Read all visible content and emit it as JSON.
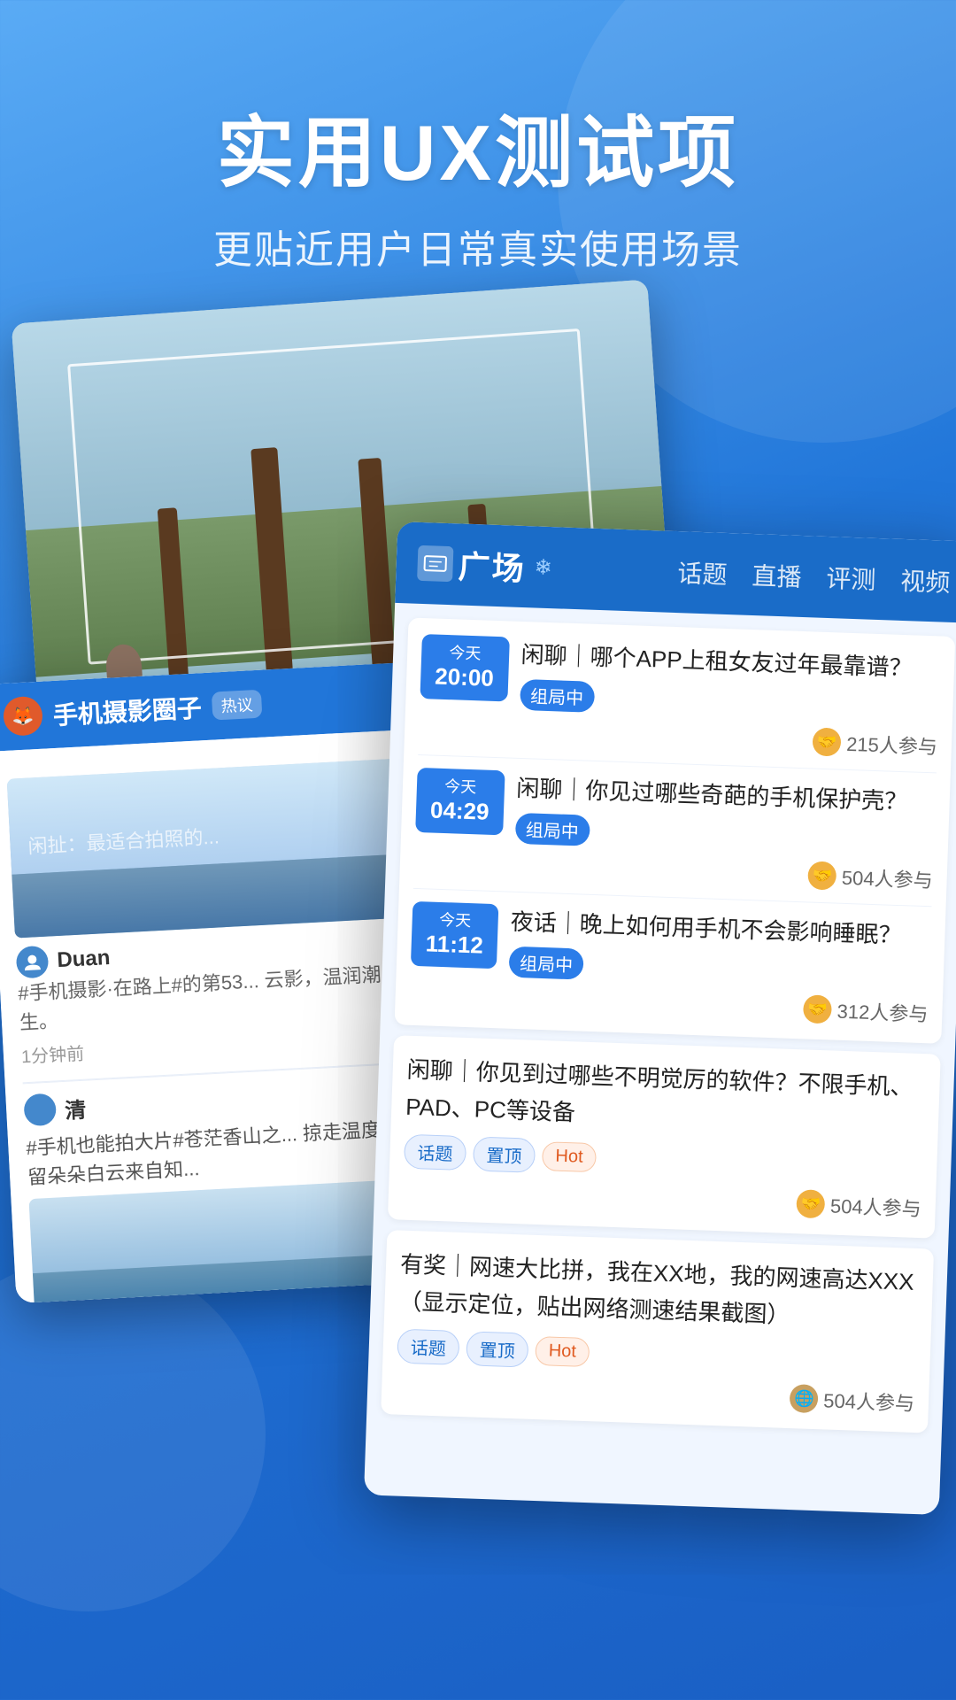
{
  "header": {
    "main_title": "实用UX测试项",
    "sub_title": "更贴近用户日常真实使用场景"
  },
  "photo_card": {
    "alt": "outdoor photo with frame overlay"
  },
  "social_card": {
    "title": "手机摄影圈子",
    "hot_badge": "热议",
    "post": {
      "text_overlay": "闲扯：最适合拍照的...",
      "username": "Duan",
      "hashtag": "#手机摄影·在路上#的第53...\n云影，温润潮生。",
      "time": "1分钟前"
    },
    "second_post": {
      "username": "清",
      "text": "#手机也能拍大片#苍茫香山之...\n掠走温度余留朵朵白云来自知..."
    }
  },
  "forum_card": {
    "logo_text": "广场",
    "nav": [
      "话题",
      "直播",
      "评测",
      "视频"
    ],
    "topics": [
      {
        "time_label": "今天",
        "time_value": "20:00",
        "title": "闲聊｜哪个APP上租女友过年最靠谱？",
        "status": "组局中",
        "participants": "215人参与"
      },
      {
        "time_label": "今天",
        "time_value": "04:29",
        "title": "闲聊｜你见过哪些奇葩的手机保护壳？",
        "status": "组局中",
        "participants": "504人参与"
      },
      {
        "time_label": "今天",
        "time_value": "11:12",
        "title": "夜话｜晚上如何用手机不会影响睡眠？",
        "status": "组局中",
        "participants": "312人参与"
      }
    ],
    "large_topics": [
      {
        "title": "闲聊｜你见到过哪些不明觉厉的软件？不限手机、PAD、PC等设备",
        "tags": [
          "话题",
          "置顶",
          "Hot"
        ],
        "participants": "504人参与"
      },
      {
        "title": "有奖｜网速大比拼，我在XX地，我的网速高达XXX（显示定位，贴出网络测速结果截图）",
        "tags": [
          "话题",
          "置顶",
          "Hot"
        ],
        "participants": "504人参与"
      }
    ]
  }
}
